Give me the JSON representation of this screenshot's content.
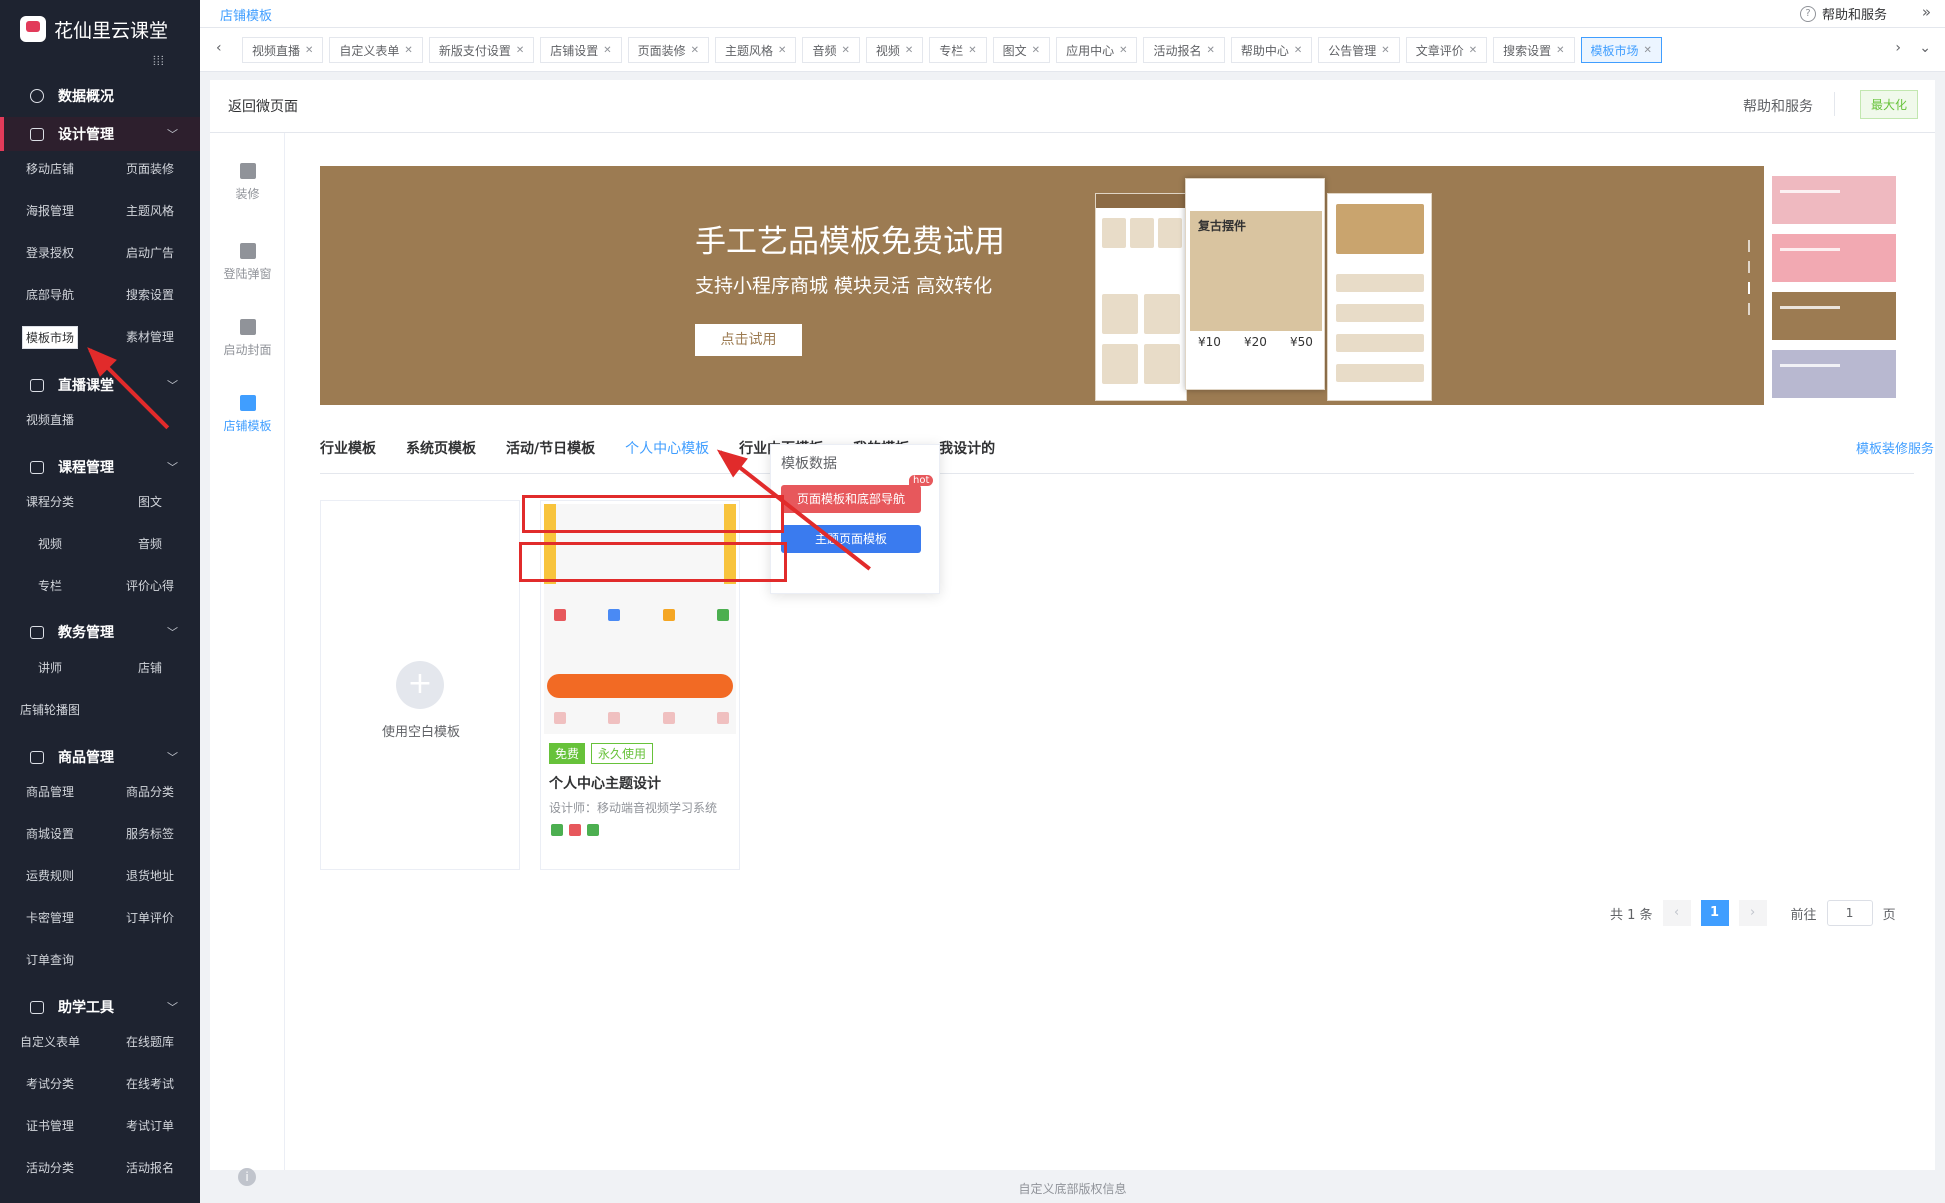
{
  "brand": {
    "name": "花仙里云课堂"
  },
  "sidebar": {
    "overview": "数据概况",
    "sections": [
      {
        "title": "设计管理",
        "items": [
          "移动店铺",
          "页面装修",
          "海报管理",
          "主题风格",
          "登录授权",
          "启动广告",
          "底部导航",
          "搜索设置",
          "模板市场",
          "素材管理"
        ]
      },
      {
        "title": "直播课堂",
        "items": [
          "视频直播"
        ]
      },
      {
        "title": "课程管理",
        "items": [
          "课程分类",
          "图文",
          "视频",
          "音频",
          "专栏",
          "评价心得"
        ]
      },
      {
        "title": "教务管理",
        "items": [
          "讲师",
          "店铺",
          "店铺轮播图"
        ]
      },
      {
        "title": "商品管理",
        "items": [
          "商品管理",
          "商品分类",
          "商城设置",
          "服务标签",
          "运费规则",
          "退货地址",
          "卡密管理",
          "订单评价",
          "订单查询"
        ]
      },
      {
        "title": "助学工具",
        "items": [
          "自定义表单",
          "在线题库",
          "考试分类",
          "在线考试",
          "证书管理",
          "考试订单",
          "活动分类",
          "活动报名"
        ]
      }
    ]
  },
  "topbar": {
    "breadcrumb": "店铺模板",
    "help": "帮助和服务"
  },
  "tabs": [
    "视频直播",
    "自定义表单",
    "新版支付设置",
    "店铺设置",
    "页面装修",
    "主题风格",
    "音频",
    "视频",
    "专栏",
    "图文",
    "应用中心",
    "活动报名",
    "帮助中心",
    "公告管理",
    "文章评价",
    "搜索设置",
    "模板市场"
  ],
  "active_tab": "模板市场",
  "panel": {
    "back": "返回微页面",
    "help": "帮助和服务",
    "maximize": "最大化"
  },
  "vnav": [
    "装修",
    "登陆弹窗",
    "启动封面",
    "店铺模板"
  ],
  "banner": {
    "title": "手工艺品模板免费试用",
    "subtitle": "支持小程序商城 模块灵活 高效转化",
    "button": "点击试用",
    "phone_title": "复古摆件",
    "prices": [
      "¥10",
      "¥20",
      "¥50"
    ]
  },
  "categories": [
    "行业模板",
    "系统页模板",
    "活动/节日模板",
    "个人中心模板",
    "行业内页模板",
    "我的模板",
    "我设计的"
  ],
  "active_category": "个人中心模板",
  "template_service": "模板装修服务",
  "popover": {
    "title": "模板数据",
    "btn1": "页面模板和底部导航",
    "btn2": "主题页面模板",
    "hot": "hot"
  },
  "blank_card": {
    "label": "使用空白模板"
  },
  "template_card": {
    "free": "免费",
    "permanent": "永久使用",
    "title": "个人中心主题设计",
    "designer": "设计师：移动端音视频学习系统"
  },
  "pagination": {
    "total": "共 1 条",
    "page": "1",
    "goto": "前往",
    "goto_value": "1",
    "unit": "页"
  },
  "footer": "自定义底部版权信息"
}
